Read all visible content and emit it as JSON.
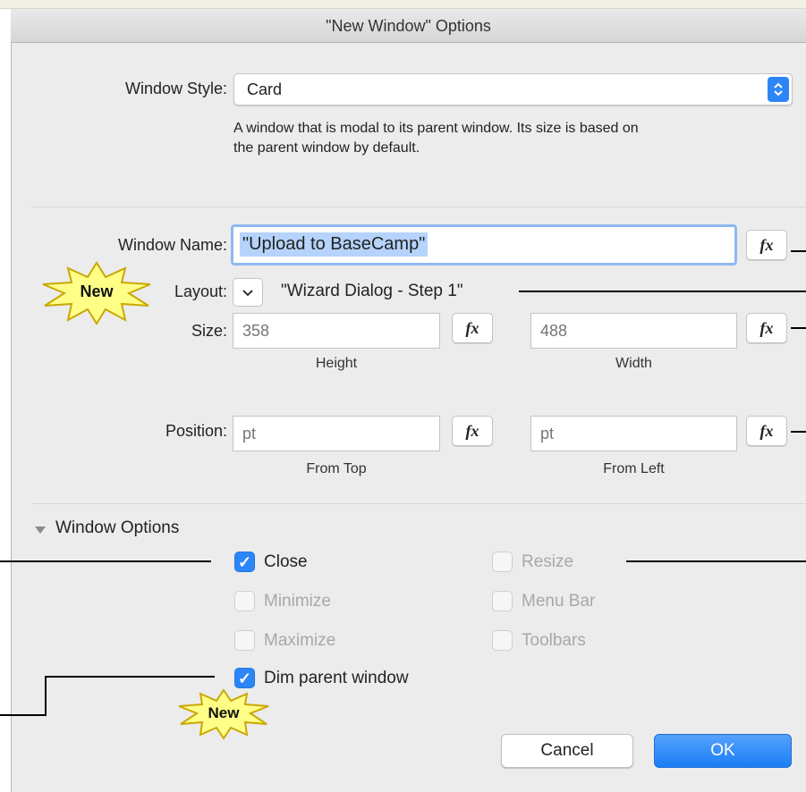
{
  "window": {
    "title": "\"New Window\" Options"
  },
  "window_style": {
    "label": "Window Style:",
    "value": "Card",
    "description_line1": "A window that is modal to its parent window. Its size is based on",
    "description_line2": "the parent window by default."
  },
  "window_name": {
    "label": "Window Name:",
    "value": "\"Upload to BaseCamp\""
  },
  "layout": {
    "label": "Layout:",
    "value": "\"Wizard Dialog - Step 1\""
  },
  "size": {
    "label": "Size:",
    "height_placeholder": "358",
    "height_caption": "Height",
    "width_placeholder": "488",
    "width_caption": "Width"
  },
  "position": {
    "label": "Position:",
    "top_placeholder": "pt",
    "top_caption": "From Top",
    "left_placeholder": "pt",
    "left_caption": "From Left"
  },
  "fx_label": "fx",
  "badge_text": "New",
  "window_options": {
    "header": "Window Options",
    "close": "Close",
    "minimize": "Minimize",
    "maximize": "Maximize",
    "dim_parent": "Dim parent window",
    "resize": "Resize",
    "menu_bar": "Menu Bar",
    "toolbars": "Toolbars"
  },
  "buttons": {
    "cancel": "Cancel",
    "ok": "OK"
  },
  "colors": {
    "accent": "#2c86f7",
    "badge_fill": "#ffff88",
    "badge_stroke": "#c9a800"
  }
}
